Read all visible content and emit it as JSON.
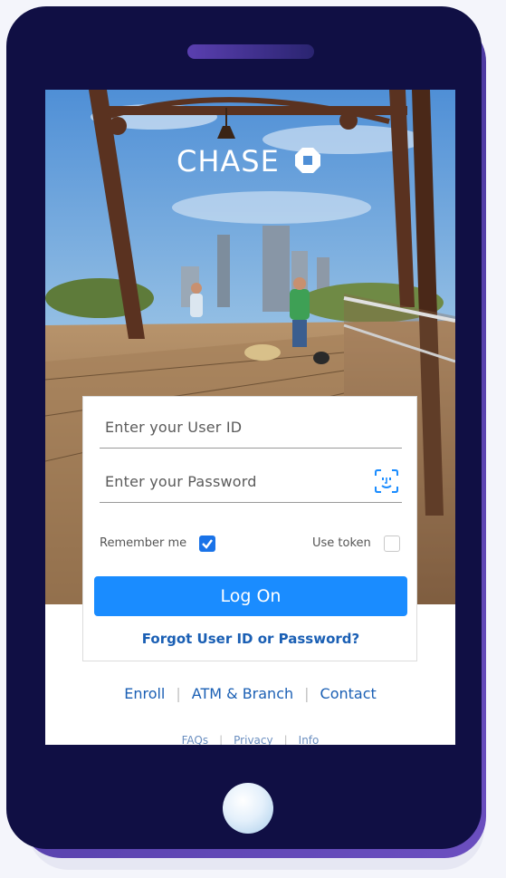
{
  "brand": {
    "name": "CHASE"
  },
  "login": {
    "user_id_placeholder": "Enter your User ID",
    "password_placeholder": "Enter your Password",
    "remember_label": "Remember me",
    "remember_checked": true,
    "token_label": "Use token",
    "token_checked": false,
    "logon_label": "Log On",
    "forgot_label": "Forgot User ID or Password?"
  },
  "links": {
    "enroll": "Enroll",
    "atm": "ATM & Branch",
    "contact": "Contact"
  },
  "sublinks": {
    "faqs": "FAQs",
    "privacy": "Privacy",
    "info": "Info"
  },
  "colors": {
    "phone_body": "#100f44",
    "accent": "#1a8cff",
    "link": "#1a5fb4"
  },
  "icons": [
    "face-id-icon",
    "chase-logo-icon",
    "checkbox-checked-icon",
    "checkbox-empty-icon",
    "home-button-icon"
  ]
}
